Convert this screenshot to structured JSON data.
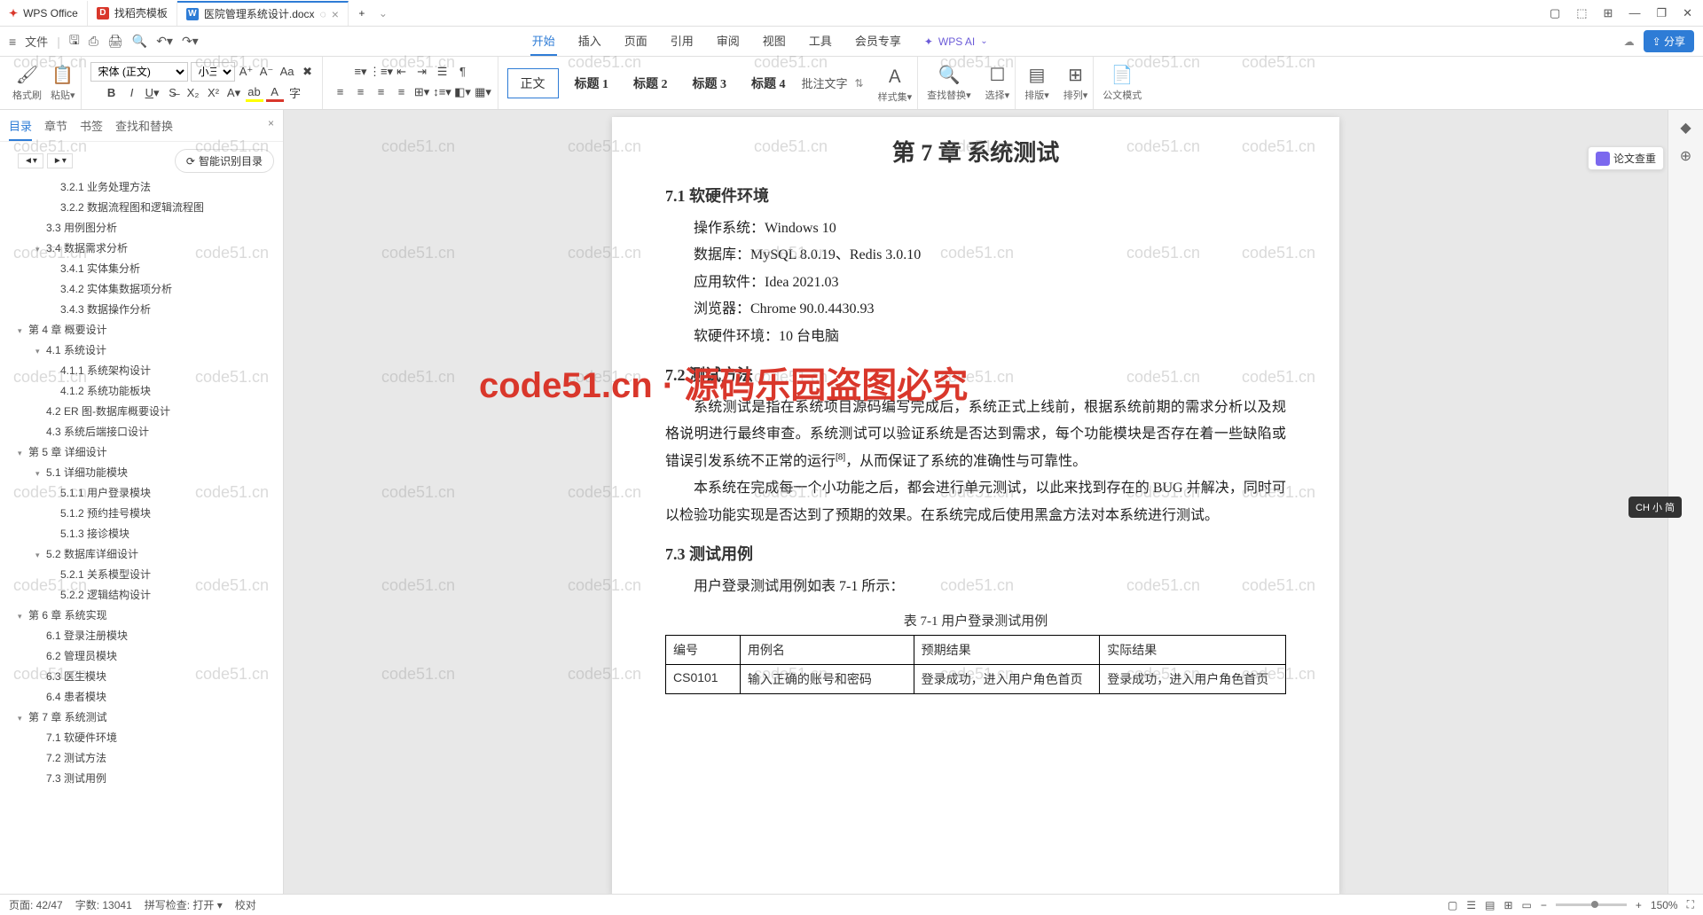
{
  "titlebar": {
    "app_name": "WPS Office",
    "tabs": [
      {
        "icon": "D",
        "icon_bg": "#d9372b",
        "label": "找稻壳模板"
      },
      {
        "icon": "W",
        "icon_bg": "#2e7cd6",
        "label": "医院管理系统设计.docx",
        "active": true
      }
    ]
  },
  "menubar": {
    "file": "文件",
    "tabs": [
      "开始",
      "插入",
      "页面",
      "引用",
      "审阅",
      "视图",
      "工具",
      "会员专享"
    ],
    "active_tab": "开始",
    "ai": "WPS AI",
    "share": "分享"
  },
  "ribbon": {
    "format_painter": "格式刷",
    "paste": "粘贴",
    "font_name": "宋体 (正文)",
    "font_size": "小三",
    "body_style": "正文",
    "headings": [
      "标题 1",
      "标题 2",
      "标题 3",
      "标题 4"
    ],
    "comment": "批注文字",
    "style_set": "样式集",
    "find_replace": "查找替换",
    "select": "选择",
    "layout1": "排版",
    "layout2": "排列",
    "official": "公文模式"
  },
  "sidebar": {
    "tabs": [
      "目录",
      "章节",
      "书签",
      "查找和替换"
    ],
    "active": "目录",
    "smart_outline": "智能识别目录",
    "items": [
      {
        "lvl": 3,
        "text": "3.2.1 业务处理方法"
      },
      {
        "lvl": 3,
        "text": "3.2.2 数据流程图和逻辑流程图"
      },
      {
        "lvl": 2,
        "text": "3.3 用例图分析"
      },
      {
        "lvl": 2,
        "text": "3.4 数据需求分析",
        "caret": true
      },
      {
        "lvl": 3,
        "text": "3.4.1 实体集分析"
      },
      {
        "lvl": 3,
        "text": "3.4.2 实体集数据项分析"
      },
      {
        "lvl": 3,
        "text": "3.4.3 数据操作分析"
      },
      {
        "lvl": 1,
        "text": "第 4 章 概要设计",
        "caret": true
      },
      {
        "lvl": 2,
        "text": "4.1 系统设计",
        "caret": true
      },
      {
        "lvl": 3,
        "text": "4.1.1 系统架构设计"
      },
      {
        "lvl": 3,
        "text": "4.1.2 系统功能板块"
      },
      {
        "lvl": 2,
        "text": "4.2 ER 图-数据库概要设计"
      },
      {
        "lvl": 2,
        "text": "4.3 系统后端接口设计"
      },
      {
        "lvl": 1,
        "text": "第 5 章 详细设计",
        "caret": true
      },
      {
        "lvl": 2,
        "text": "5.1 详细功能模块",
        "caret": true
      },
      {
        "lvl": 3,
        "text": "5.1.1 用户登录模块"
      },
      {
        "lvl": 3,
        "text": "5.1.2 预约挂号模块"
      },
      {
        "lvl": 3,
        "text": "5.1.3 接诊模块"
      },
      {
        "lvl": 2,
        "text": "5.2 数据库详细设计",
        "caret": true
      },
      {
        "lvl": 3,
        "text": "5.2.1 关系模型设计"
      },
      {
        "lvl": 3,
        "text": "5.2.2 逻辑结构设计"
      },
      {
        "lvl": 1,
        "text": "第 6 章 系统实现",
        "caret": true
      },
      {
        "lvl": 2,
        "text": "6.1 登录注册模块"
      },
      {
        "lvl": 2,
        "text": "6.2 管理员模块"
      },
      {
        "lvl": 2,
        "text": "6.3 医生模块"
      },
      {
        "lvl": 2,
        "text": "6.4 患者模块"
      },
      {
        "lvl": 1,
        "text": "第 7 章 系统测试",
        "caret": true
      },
      {
        "lvl": 2,
        "text": "7.1 软硬件环境"
      },
      {
        "lvl": 2,
        "text": "7.2 测试方法"
      },
      {
        "lvl": 2,
        "text": "7.3 测试用例"
      }
    ]
  },
  "doc": {
    "chapter_title": "第 7 章  系统测试",
    "s1_title": "7.1  软硬件环境",
    "s1_lines": {
      "os": "操作系统：Windows 10",
      "db": "数据库：MySQL 8.0.19、Redis 3.0.10",
      "app": "应用软件：Idea 2021.03",
      "browser": "浏览器：Chrome 90.0.4430.93",
      "hw": "软硬件环境：10 台电脑"
    },
    "s2_title": "7.2  测试方法",
    "s2_p1a": "系统测试是指在系统项目源码编写完成后，系统正式上线前，根据系统前期的需求分析以及规格说明进行最终审查。系统测试可以验证系统是否达到需求，每个功能模块是否存在着一些缺陷或错误引发系统不正常的运行",
    "s2_p1b": "，从而保证了系统的准确性与可靠性。",
    "s2_ref": "[8]",
    "s2_p2": "本系统在完成每一个小功能之后，都会进行单元测试，以此来找到存在的 BUG 并解决，同时可以检验功能实现是否达到了预期的效果。在系统完成后使用黑盒方法对本系统进行测试。",
    "s3_title": "7.3  测试用例",
    "s3_intro": "用户登录测试用例如表 7-1 所示：",
    "table_caption": "表 7-1  用户登录测试用例",
    "table": {
      "headers": [
        "编号",
        "用例名",
        "预期结果",
        "实际结果"
      ],
      "row1": [
        "CS0101",
        "输入正确的账号和密码",
        "登录成功，进入用户角色首页",
        "登录成功，进入用户角色首页"
      ]
    }
  },
  "statusbar": {
    "page": "页面: 42/47",
    "words": "字数: 13041",
    "spell": "拼写检查: 打开",
    "proof": "校对",
    "zoom": "150%"
  },
  "float": {
    "review": "论文查重"
  },
  "watermark": "code51.cn",
  "big_watermark": "code51.cn · 源码乐园盗图必究",
  "ime": "CH 小 简"
}
